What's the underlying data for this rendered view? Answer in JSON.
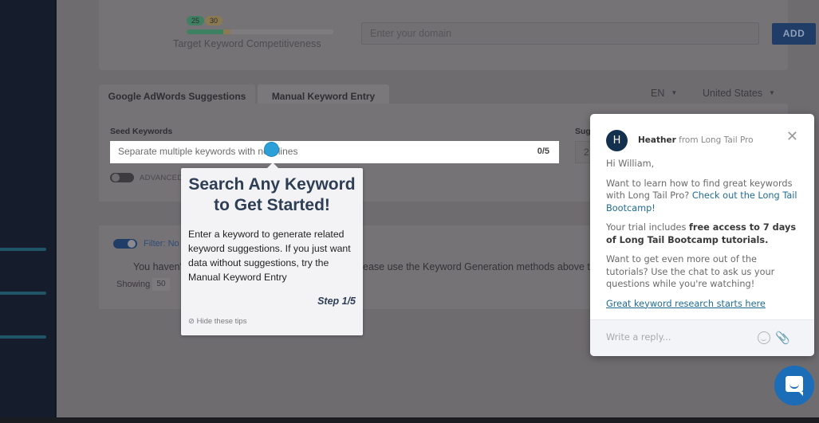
{
  "sidebar": {
    "menu_bars": 3
  },
  "competitiveness": {
    "label": "Target Keyword Competitiveness",
    "badge_low": "25",
    "badge_high": "30",
    "fill_low_percent": 25,
    "fill_high_percent": 30,
    "colors": {
      "low": "#3f8062",
      "high": "#8a7a52"
    }
  },
  "domain": {
    "placeholder": "Enter your domain",
    "add_label": "ADD"
  },
  "tabs": [
    {
      "label": "Google AdWords Suggestions",
      "active": true
    },
    {
      "label": "Manual Keyword Entry",
      "active": false
    }
  ],
  "language": {
    "value": "EN"
  },
  "country": {
    "value": "United States"
  },
  "seed": {
    "label": "Seed Keywords",
    "placeholder": "Separate multiple keywords with new lines",
    "count": "0/5"
  },
  "suggestions": {
    "label": "Sug",
    "value": "2"
  },
  "advanced": {
    "label": "ADVANCED"
  },
  "filter": {
    "label": "Filter:",
    "value": "No"
  },
  "results": {
    "empty_prefix": "You haven'",
    "empty_suffix": "ease use the Keyword Generation methods above to",
    "showing_label": "Showing",
    "page_size": "50"
  },
  "tip": {
    "title": "Search Any Keyword to Get Started!",
    "body": "Enter a keyword to generate related keyword suggestions. If you just want data without suggestions, try the Manual Keyword Entry",
    "step": "Step 1/5",
    "hide": "⊘ Hide these tips"
  },
  "chat": {
    "avatar_initial": "H",
    "agent_name": "Heather",
    "agent_company": "from Long Tail Pro",
    "greeting": "Hi William,",
    "msg1": "Want to learn how to find great keywords with Long Tail Pro?",
    "msg1_link": "Check out the Long Tail Bootcamp!",
    "msg2_prefix": "Your trial includes",
    "msg2_bold": "free access to 7 days of Long Tail Bootcamp tutorials.",
    "msg3": "Want to get even more out of the tutorials? Use the chat to ask us your questions while you're watching!",
    "link": "Great keyword research starts here",
    "reply_placeholder": "Write a reply...",
    "accent": "#1b6db7"
  }
}
